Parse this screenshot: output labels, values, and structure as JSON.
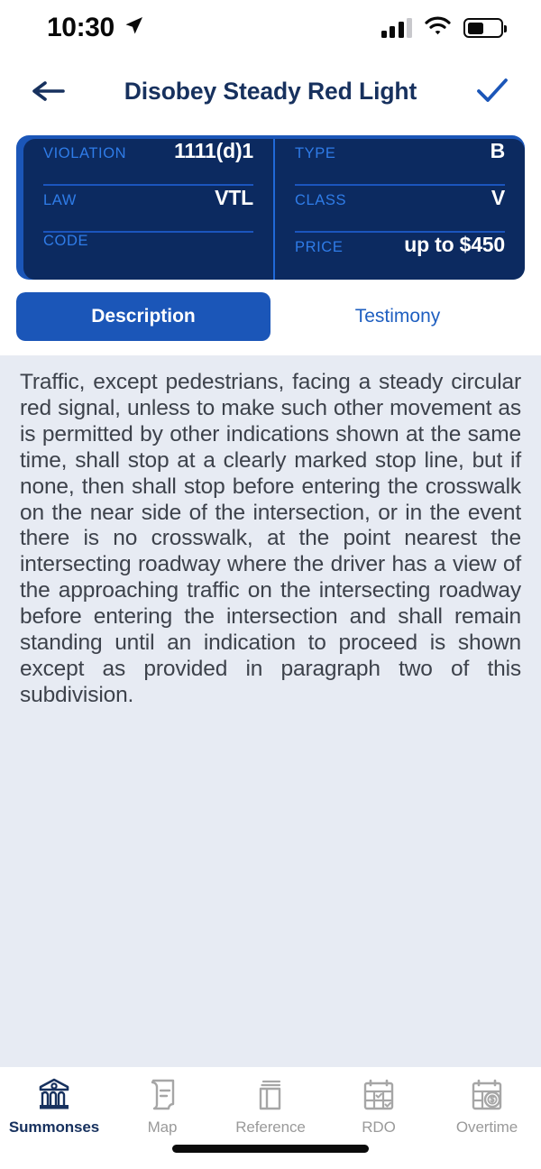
{
  "status_bar": {
    "time": "10:30",
    "location_icon": "location-arrow-icon",
    "signal_icon": "cellular-signal-icon",
    "signal_bars_filled": 3,
    "signal_bars_total": 4,
    "wifi_icon": "wifi-icon",
    "battery_icon": "battery-icon",
    "battery_level_percent": 45
  },
  "nav_bar": {
    "back_icon": "back-arrow-icon",
    "title": "Disobey Steady Red Light",
    "confirm_icon": "checkmark-icon"
  },
  "info_card": {
    "left_column": [
      {
        "label": "VIOLATION",
        "value": "1111(d)1"
      },
      {
        "label": "LAW",
        "value": "VTL"
      },
      {
        "label": "CODE",
        "value": ""
      }
    ],
    "right_column": [
      {
        "label": "TYPE",
        "value": "B"
      },
      {
        "label": "CLASS",
        "value": "V"
      },
      {
        "label": "PRICE",
        "value": "up to $450"
      }
    ]
  },
  "tabs": {
    "items": [
      {
        "label": "Description",
        "active": true
      },
      {
        "label": "Testimony",
        "active": false
      }
    ]
  },
  "description": {
    "body": "Traffic, except pedestrians, facing a steady circular red signal, unless to make such other movement as is permitted by other indications shown at the same time, shall stop at a clearly marked stop line, but if none, then shall stop before entering the crosswalk on the near side of the intersection, or in the event there is no crosswalk, at the point nearest the intersecting roadway where the driver has a view of the approaching traffic on the intersecting roadway before entering the intersection and shall remain standing until an indication to proceed is shown except as provided in paragraph two of this subdivision."
  },
  "bottom_tab_bar": {
    "items": [
      {
        "label": "Summonses",
        "icon": "courthouse-icon",
        "active": true
      },
      {
        "label": "Map",
        "icon": "scroll-document-icon",
        "active": false
      },
      {
        "label": "Reference",
        "icon": "book-icon",
        "active": false
      },
      {
        "label": "RDO",
        "icon": "calendar-check-icon",
        "active": false
      },
      {
        "label": "Overtime",
        "icon": "calendar-dollar-icon",
        "active": false
      }
    ]
  },
  "colors": {
    "brand_navy": "#17315e",
    "brand_blue": "#1b56b8",
    "card_dark": "#0c2a60",
    "label_blue": "#2f7ce8",
    "page_background": "#e7ebf3",
    "inactive_gray": "#9a9a9a"
  }
}
